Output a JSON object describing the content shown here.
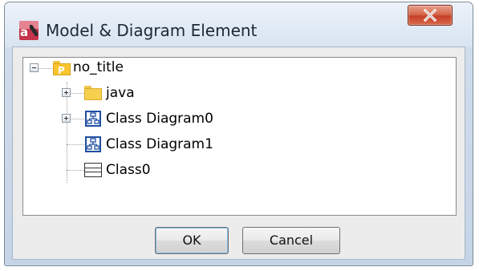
{
  "window": {
    "title": "Model & Diagram Element",
    "app_icon": "astah-app-icon",
    "close_icon": "close-icon"
  },
  "tree": {
    "root": {
      "label": "no_title",
      "icon": "package-icon",
      "icon_letter": "P",
      "expanded": true
    },
    "children": [
      {
        "label": "java",
        "icon": "folder-icon",
        "expandable": true
      },
      {
        "label": "Class Diagram0",
        "icon": "class-diagram-icon",
        "expandable": true
      },
      {
        "label": "Class Diagram1",
        "icon": "class-diagram-icon",
        "expandable": false
      },
      {
        "label": "Class0",
        "icon": "class-icon",
        "expandable": false
      }
    ]
  },
  "buttons": {
    "ok_label": "OK",
    "cancel_label": "Cancel"
  },
  "colors": {
    "package_yellow": "#f8c52f",
    "diagram_blue": "#1f4ea0",
    "close_red": "#c6402a"
  }
}
